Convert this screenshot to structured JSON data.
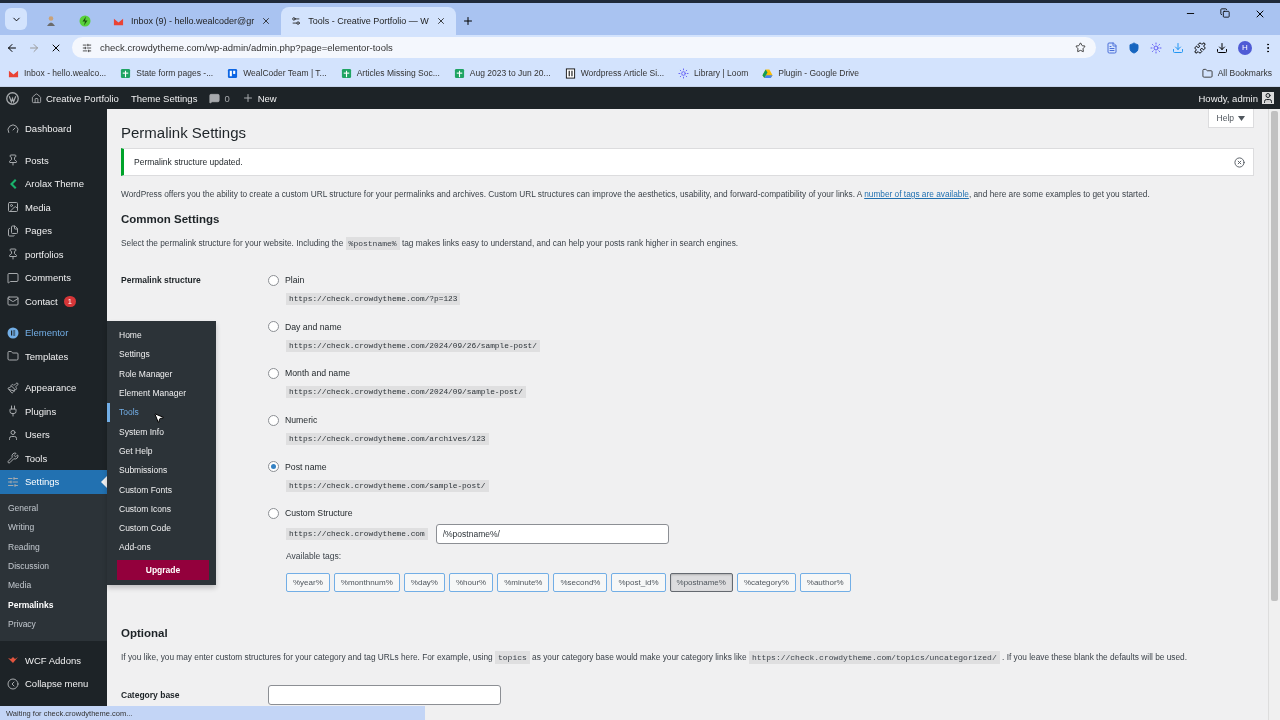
{
  "browser": {
    "tabs": [
      {
        "kind": "pinned",
        "selected": false
      },
      {
        "kind": "pinned",
        "selected": false
      },
      {
        "kind": "page",
        "title": "Inbox (9) - hello.wealcoder@gr",
        "selected": false
      },
      {
        "kind": "page",
        "title": "Tools - Creative Portfolio — W",
        "selected": true
      }
    ],
    "address": "check.crowdytheme.com/wp-admin/admin.php?page=elementor-tools",
    "loading": true,
    "profile_initial": "H",
    "bookmarks": [
      "Inbox - hello.wealco...",
      "State form pages -...",
      "WealCoder Team | T...",
      "Articles Missing Soc...",
      "Aug 2023 to Jun 20...",
      "Wordpress Article Si...",
      "Library | Loom",
      "Plugin - Google Drive"
    ],
    "all_bookmarks": "All Bookmarks"
  },
  "admin_bar": {
    "site": "Creative Portfolio",
    "theme_settings": "Theme Settings",
    "comments": "0",
    "new": "New",
    "greeting": "Howdy, admin"
  },
  "sidebar": {
    "groups": [
      {
        "items": [
          {
            "label": "Dashboard",
            "selected": false,
            "highlighted": false
          }
        ]
      },
      {
        "items": [
          {
            "label": "Posts",
            "selected": false,
            "highlighted": false
          },
          {
            "label": "Arolax Theme",
            "selected": false,
            "highlighted": false
          },
          {
            "label": "Media",
            "selected": false,
            "highlighted": false
          },
          {
            "label": "Pages",
            "selected": false,
            "highlighted": false
          },
          {
            "label": "portfolios",
            "selected": false,
            "highlighted": false
          },
          {
            "label": "Comments",
            "selected": false,
            "highlighted": false
          },
          {
            "label": "Contact",
            "badge": "1",
            "selected": false,
            "highlighted": false
          }
        ]
      },
      {
        "items": [
          {
            "label": "Elementor",
            "selected": false,
            "highlighted": true
          },
          {
            "label": "Templates",
            "selected": false,
            "highlighted": false
          }
        ]
      },
      {
        "items": [
          {
            "label": "Appearance",
            "selected": false,
            "highlighted": false
          },
          {
            "label": "Plugins",
            "selected": false,
            "highlighted": false
          },
          {
            "label": "Users",
            "selected": false,
            "highlighted": false
          },
          {
            "label": "Tools",
            "selected": false,
            "highlighted": false
          },
          {
            "label": "Settings",
            "selected": true,
            "highlighted": false,
            "expanded": true,
            "children": [
              {
                "label": "General",
                "selected": false
              },
              {
                "label": "Writing",
                "selected": false
              },
              {
                "label": "Reading",
                "selected": false
              },
              {
                "label": "Discussion",
                "selected": false
              },
              {
                "label": "Media",
                "selected": false
              },
              {
                "label": "Permalinks",
                "selected": true
              },
              {
                "label": "Privacy",
                "selected": false
              }
            ]
          }
        ]
      },
      {
        "items": [
          {
            "label": "WCF Addons",
            "selected": false,
            "highlighted": false
          },
          {
            "label": "Collapse menu",
            "selected": false,
            "highlighted": false
          }
        ]
      }
    ]
  },
  "flyout": {
    "items": [
      {
        "label": "Home",
        "selected": false
      },
      {
        "label": "Settings",
        "selected": false
      },
      {
        "label": "Role Manager",
        "selected": false
      },
      {
        "label": "Element Manager",
        "selected": false
      },
      {
        "label": "Tools",
        "selected": true
      },
      {
        "label": "System Info",
        "selected": false
      },
      {
        "label": "Get Help",
        "selected": false
      },
      {
        "label": "Submissions",
        "selected": false
      },
      {
        "label": "Custom Fonts",
        "selected": false
      },
      {
        "label": "Custom Icons",
        "selected": false
      },
      {
        "label": "Custom Code",
        "selected": false
      },
      {
        "label": "Add-ons",
        "selected": false
      }
    ],
    "upgrade": "Upgrade"
  },
  "page": {
    "title": "Permalink Settings",
    "help": "Help",
    "notice": "Permalink structure updated.",
    "intro": [
      {
        "kind": "text",
        "text": "WordPress offers you the ability to create a custom URL structure for your permalinks and archives. Custom URL structures can improve the aesthetics, usability, and forward-compatibility of your links. A "
      },
      {
        "kind": "link",
        "text": "number of tags are available"
      },
      {
        "kind": "text",
        "text": ", and here are some examples to get you started."
      }
    ],
    "common_heading": "Common Settings",
    "common_description": [
      {
        "kind": "text",
        "text": "Select the permalink structure for your website. Including the "
      },
      {
        "kind": "code",
        "text": "%postname%"
      },
      {
        "kind": "text",
        "text": " tag makes links easy to understand, and can help your posts rank higher in search engines."
      }
    ],
    "structure_label": "Permalink structure",
    "options": [
      {
        "kind": "preset",
        "label": "Plain",
        "example": "https://check.crowdytheme.com/?p=123",
        "selected": false
      },
      {
        "kind": "preset",
        "label": "Day and name",
        "example": "https://check.crowdytheme.com/2024/09/26/sample-post/",
        "selected": false
      },
      {
        "kind": "preset",
        "label": "Month and name",
        "example": "https://check.crowdytheme.com/2024/09/sample-post/",
        "selected": false
      },
      {
        "kind": "preset",
        "label": "Numeric",
        "example": "https://check.crowdytheme.com/archives/123",
        "selected": false
      },
      {
        "kind": "preset",
        "label": "Post name",
        "example": "https://check.crowdytheme.com/sample-post/",
        "selected": true
      },
      {
        "kind": "custom",
        "label": "Custom Structure",
        "prefix": "https://check.crowdytheme.com",
        "value": "/%postname%/",
        "selected": false
      }
    ],
    "tags_label": "Available tags:",
    "tags": [
      {
        "label": "%year%",
        "selected": false
      },
      {
        "label": "%monthnum%",
        "selected": false
      },
      {
        "label": "%day%",
        "selected": false
      },
      {
        "label": "%hour%",
        "selected": false
      },
      {
        "label": "%minute%",
        "selected": false
      },
      {
        "label": "%second%",
        "selected": false
      },
      {
        "label": "%post_id%",
        "selected": false
      },
      {
        "label": "%postname%",
        "selected": true
      },
      {
        "label": "%category%",
        "selected": false
      },
      {
        "label": "%author%",
        "selected": false
      }
    ],
    "optional_heading": "Optional",
    "optional_description": [
      {
        "kind": "text",
        "text": "If you like, you may enter custom structures for your category and tag URLs here. For example, using "
      },
      {
        "kind": "code",
        "text": "topics"
      },
      {
        "kind": "text",
        "text": " as your category base would make your category links like "
      },
      {
        "kind": "code",
        "text": "https://check.crowdytheme.com/topics/uncategorized/"
      },
      {
        "kind": "text",
        "text": " . If you leave these blank the defaults will be used."
      }
    ],
    "category_base_label": "Category base"
  },
  "status": "Waiting for check.crowdytheme.com..."
}
